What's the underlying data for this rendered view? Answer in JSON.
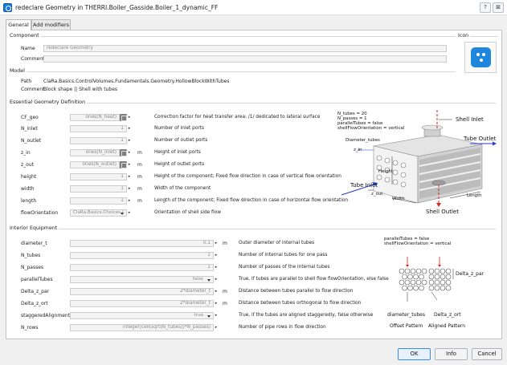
{
  "window": {
    "title": "redeclare Geometry in THERRI.Boiler_Gasside.Boiler_1_dynamic_FF",
    "help_glyph": "?",
    "close_glyph": "⊠"
  },
  "tabs": [
    "General",
    "Add modifiers"
  ],
  "component": {
    "section": "Component",
    "name_label": "Name",
    "name_value": "redeclare Geometry",
    "comment_label": "Comment",
    "comment_value": ""
  },
  "icon_section": "Icon",
  "model": {
    "section": "Model",
    "path_label": "Path",
    "path_value": "ClaRa.Basics.ControlVolumes.Fundamentals.Geometry.HollowBlockWithTubes",
    "comment_label": "Comment",
    "comment_value": "Block shape || Shell with tubes"
  },
  "essential": {
    "section": "Essential Geometry Definition",
    "rows": [
      {
        "name": "CF_geo",
        "value": "ones(N_heat)",
        "unit": "",
        "desc": "Correction factor for heat transfer area: /1/ dedicated to lateral surface"
      },
      {
        "name": "N_inlet",
        "value": "1",
        "unit": "",
        "desc": "Number of inlet ports"
      },
      {
        "name": "N_outlet",
        "value": "1",
        "unit": "",
        "desc": "Number of outlet ports"
      },
      {
        "name": "z_in",
        "value": "ones(N_inlet)",
        "unit": "m",
        "desc": "Height of inlet ports"
      },
      {
        "name": "z_out",
        "value": "ones(N_outlet)",
        "unit": "m",
        "desc": "Height of outlet ports"
      },
      {
        "name": "height",
        "value": "1",
        "unit": "m",
        "desc": "Height of the component; Fixed flow direction in case of vertical flow orientation"
      },
      {
        "name": "width",
        "value": "1",
        "unit": "m",
        "desc": "Width of the component"
      },
      {
        "name": "length",
        "value": "1",
        "unit": "m",
        "desc": "Length of the component; Fixed flow direction in case of horizontal flow orientation"
      },
      {
        "name": "flowOrientation",
        "value": "ClaRa.Basics.Choices.(",
        "unit": "",
        "desc": "Orientation of shell side flow"
      }
    ]
  },
  "diagram1": {
    "info": [
      "N_tubes = 20",
      "N_passes = 1",
      "parallelTubes = false",
      "shellFlowOrientation = vertical"
    ],
    "labels": {
      "shell_inlet": "Shell Inlet",
      "diameter_tubes": "Diameter_tubes",
      "tube_outlet": "Tube Outlet",
      "z_in": "z_in",
      "height": "Height",
      "tube_inlet": "Tube Inlet",
      "z_out": "z_out",
      "width": "Width",
      "length": "Length",
      "shell_outlet": "Shell Outlet"
    }
  },
  "interior": {
    "section": "Interior Equipment",
    "rows": [
      {
        "name": "diameter_t",
        "value": "0.1",
        "unit": "m",
        "desc": "Outer diameter of internal tubes"
      },
      {
        "name": "N_tubes",
        "value": "1",
        "unit": "",
        "desc": "Number of internal tubes for one pass"
      },
      {
        "name": "N_passes",
        "value": "1",
        "unit": "",
        "desc": "Number of passes of the internal tubes"
      },
      {
        "name": "parallelTubes",
        "value": "false",
        "unit": "",
        "desc": "True, if tubes are parallel to shell flow flowOrientation, else false"
      },
      {
        "name": "Delta_z_par",
        "value": "2*diameter_t",
        "unit": "m",
        "desc": "Distance between tubes parallel to flow direction"
      },
      {
        "name": "Delta_z_ort",
        "value": "2*diameter_t",
        "unit": "m",
        "desc": "Distance between tubes orthogonal to flow direction"
      },
      {
        "name": "staggeredAlignment",
        "value": "true",
        "unit": "",
        "desc": "True, if the tubes are aligned staggeredly, false otherwise"
      },
      {
        "name": "N_rows",
        "value": "integer(ceil(sqrt(N_tubes))*N_passes)",
        "unit": "",
        "desc": "Number of pipe rows in flow direction"
      }
    ]
  },
  "diagram2": {
    "info": [
      "parallelTubes = false",
      "shellFlowOrientation = vertical"
    ],
    "labels": {
      "delta_z_par": "Delta_z_par",
      "diameter_tubes": "diameter_tubes",
      "delta_z_ort": "Delta_z_ort",
      "offset": "Offset Pattern",
      "aligned": "Aligned Pattern"
    }
  },
  "buttons": {
    "ok": "OK",
    "info": "Info",
    "cancel": "Cancel"
  },
  "colors": {
    "accent": "#1a7ad6",
    "arrow_red": "#e0231d",
    "arrow_blue": "#1f3ccf"
  }
}
